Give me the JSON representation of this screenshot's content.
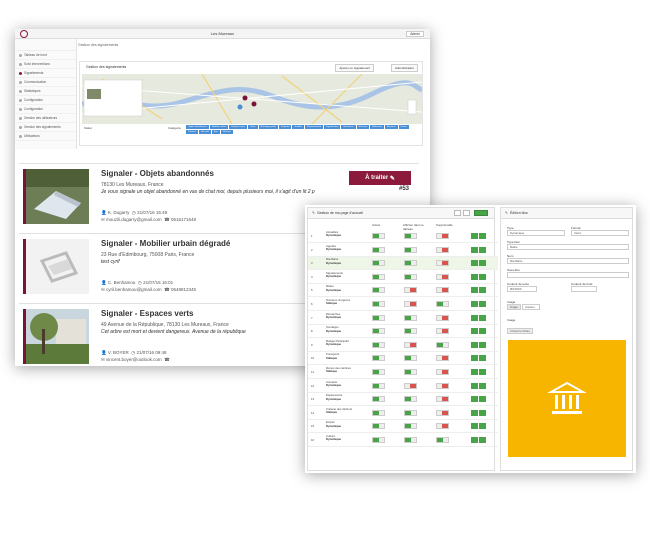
{
  "back_window": {
    "title": "Les Mureaux",
    "user_label": "Admin",
    "breadcrumb": "Gestion des signalements",
    "sidebar_items": [
      "Tableau de bord",
      "Suivi interventions",
      "Signalements",
      "Communication",
      "Statistiques",
      "Configuration",
      "Configuration",
      "Gestion des utilisateurs",
      "Gestion des signalements",
      "Utilisateurs"
    ],
    "map_panel": {
      "title": "Gestion des signalements",
      "btn_add": "Ajouter un signalement",
      "btn_export": "Administration",
      "filter_label": "Statut",
      "filter_label2": "Catégorie",
      "chips": [
        "Objets abandonnés",
        "Mobilier urbain",
        "Espaces verts",
        "Voirie",
        "Éclairage public",
        "Propreté",
        "Graffitis",
        "Stationnement",
        "Signalisation",
        "Nuisances",
        "Réseaux",
        "Bâtiments",
        "Animaux",
        "Divers",
        "Travaux",
        "Sécurité",
        "Eau",
        "Déchets"
      ]
    },
    "reports": [
      {
        "title": "Signaler - Objets abandonnés",
        "address": "78130 Les Mureaux, France",
        "description": "Je vous signale un objet abandonné en vas de chat moi, depuis plusieurs moi, il s'agit d'un lit 2 p",
        "author": "K. Dugarry",
        "date": "21/07/16 15:49",
        "email": "mouzili.dugarry@gmail.com",
        "phone": "0616171648",
        "status": "À traiter",
        "number": "#53"
      },
      {
        "title": "Signaler - Mobilier urbain dégradé",
        "address": "23 Rue d'Edimbourg, 75008 Paris, France",
        "description": "test cyrif",
        "author": "C. Benhamou",
        "date": "21/07/16 16:01",
        "email": "cyril.benhamou@gmail.com",
        "phone": "0648812345",
        "status": "",
        "number": ""
      },
      {
        "title": "Signaler - Espaces verts",
        "address": "49 Avenue de la République, 78130 Les Mureaux, France",
        "description": "Cet arbre est mort et devient dangereux. Avenue de la république",
        "author": "V. BOYER",
        "date": "21/07/16 09:48",
        "email": "vincent.boyer@outlook.com",
        "phone": "",
        "status": "",
        "number": ""
      }
    ]
  },
  "front_window": {
    "left_panel": {
      "title": "Gestion de ma page d'accueil",
      "col_active": "Activé",
      "col_display": "Afficher dans le tableau",
      "col_delete": "Supprimable",
      "rows": [
        {
          "idx": "1",
          "name": "Actualités",
          "sub": "Dynamique"
        },
        {
          "idx": "2",
          "name": "Agenda",
          "sub": "Dynamique"
        },
        {
          "idx": "3",
          "name": "Ma Mairie",
          "sub": "Dynamique"
        },
        {
          "idx": "4",
          "name": "Signalements",
          "sub": "Dynamique"
        },
        {
          "idx": "5",
          "name": "Météo",
          "sub": "Dynamique"
        },
        {
          "idx": "6",
          "name": "Numéros d'urgence",
          "sub": "Statique"
        },
        {
          "idx": "7",
          "name": "Démarches",
          "sub": "Dynamique"
        },
        {
          "idx": "8",
          "name": "Sondages",
          "sub": "Dynamique"
        },
        {
          "idx": "9",
          "name": "Budget Participatif",
          "sub": "Dynamique"
        },
        {
          "idx": "10",
          "name": "Transports",
          "sub": "Statique"
        },
        {
          "idx": "11",
          "name": "Menus des cantines",
          "sub": "Statique"
        },
        {
          "idx": "12",
          "name": "Annuaire",
          "sub": "Dynamique"
        },
        {
          "idx": "13",
          "name": "Équipements",
          "sub": "Dynamique"
        },
        {
          "idx": "14",
          "name": "Collecte des déchets",
          "sub": "Statique"
        },
        {
          "idx": "15",
          "name": "Emploi",
          "sub": "Dynamique"
        },
        {
          "idx": "16",
          "name": "Culture",
          "sub": "Dynamique"
        }
      ]
    },
    "right_panel": {
      "title": "Édition bloc",
      "type_label": "Type",
      "type_value": "Dynamique",
      "format_label": "Format",
      "format_value": "Carré",
      "type_bloc_label": "Type bloc",
      "type_bloc_value": "Mairie",
      "name_label": "Nom",
      "name_value": "Ma Mairie",
      "subtitle_label": "Sous-titre",
      "color_label": "Couleur de texte",
      "color_value": "#FFFFFF",
      "bg_label": "Couleur de fond",
      "image_label": "Image",
      "btn_image": "Image",
      "btn_color": "Couleur",
      "image_section": "Image",
      "file_btn": "Choisir le fichier",
      "accent_color": "#f7b500"
    }
  }
}
